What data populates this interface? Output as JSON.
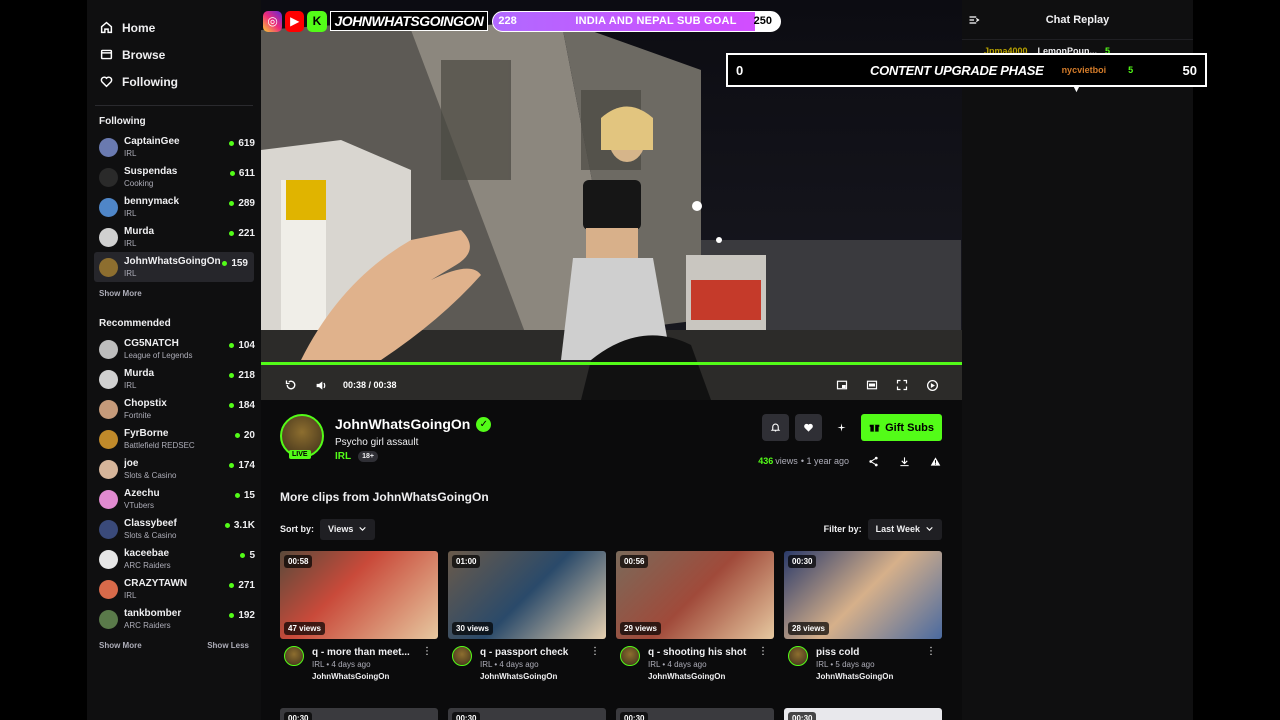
{
  "sidebar": {
    "nav": [
      {
        "label": "Home",
        "icon": "home-icon"
      },
      {
        "label": "Browse",
        "icon": "browse-icon"
      },
      {
        "label": "Following",
        "icon": "heart-icon"
      }
    ],
    "following_title": "Following",
    "following": [
      {
        "name": "CaptainGee",
        "category": "IRL",
        "viewers": "619",
        "color": "#6a7ab0"
      },
      {
        "name": "Suspendas",
        "category": "Cooking",
        "viewers": "611",
        "color": "#2a2a2a"
      },
      {
        "name": "bennymack",
        "category": "IRL",
        "viewers": "289",
        "color": "#4f86c8"
      },
      {
        "name": "Murda",
        "category": "IRL",
        "viewers": "221",
        "color": "#d0d0d0"
      },
      {
        "name": "JohnWhatsGoingOn",
        "category": "IRL",
        "viewers": "159",
        "color": "#8d6e2f",
        "active": true
      }
    ],
    "show_more": "Show More",
    "recommended_title": "Recommended",
    "recommended": [
      {
        "name": "CG5NATCH",
        "category": "League of Legends",
        "viewers": "104",
        "color": "#bdbdbd"
      },
      {
        "name": "Murda",
        "category": "IRL",
        "viewers": "218",
        "color": "#d0d0d0"
      },
      {
        "name": "Chopstix",
        "category": "Fortnite",
        "viewers": "184",
        "color": "#c59a7a"
      },
      {
        "name": "FyrBorne",
        "category": "Battlefield REDSEC",
        "viewers": "20",
        "color": "#c08a2a"
      },
      {
        "name": "joe",
        "category": "Slots & Casino",
        "viewers": "174",
        "color": "#d6b59a"
      },
      {
        "name": "Azechu",
        "category": "VTubers",
        "viewers": "15",
        "color": "#e08ad0"
      },
      {
        "name": "Classybeef",
        "category": "Slots & Casino",
        "viewers": "3.1K",
        "color": "#3a4a7a"
      },
      {
        "name": "kaceebae",
        "category": "ARC Raiders",
        "viewers": "5",
        "color": "#e6e6e6"
      },
      {
        "name": "CRAZYTAWN",
        "category": "IRL",
        "viewers": "271",
        "color": "#d86a4a"
      },
      {
        "name": "tankbomber",
        "category": "ARC Raiders",
        "viewers": "192",
        "color": "#5a7a4a"
      }
    ],
    "show_more_2": "Show More",
    "show_less": "Show Less"
  },
  "video": {
    "overlay": {
      "brand": "JOHNWHATSGOINGON",
      "goal_current": "228",
      "goal_label": "INDIA AND NEPAL SUB GOAL",
      "goal_target": "250",
      "goal_progress": 0.912
    },
    "time": "00:38 / 00:38",
    "progress": 1.0
  },
  "banner": {
    "left_num": "0",
    "title": "CONTENT UPGRADE PHASE",
    "right_num": "50",
    "chat_user": "nycvietboi",
    "chat_count": "5"
  },
  "clip": {
    "channel": "JohnWhatsGoingOn",
    "title": "Psycho girl assault",
    "live_badge": "LIVE",
    "category": "IRL",
    "age_badge": "18+",
    "views": "436",
    "views_word": "views",
    "age": "• 1 year ago",
    "gift_label": "Gift Subs"
  },
  "more": {
    "title": "More clips from JohnWhatsGoingOn",
    "sort_label": "Sort by:",
    "sort_value": "Views",
    "filter_label": "Filter by:",
    "filter_value": "Last Week",
    "clips": [
      {
        "duration": "00:58",
        "views": "47 views",
        "title": "q - more than meet...",
        "meta": "IRL • 4 days ago",
        "channel": "JohnWhatsGoingOn"
      },
      {
        "duration": "01:00",
        "views": "30 views",
        "title": "q - passport check",
        "meta": "IRL • 4 days ago",
        "channel": "JohnWhatsGoingOn"
      },
      {
        "duration": "00:56",
        "views": "29 views",
        "title": "q - shooting his shot",
        "meta": "IRL • 4 days ago",
        "channel": "JohnWhatsGoingOn"
      },
      {
        "duration": "00:30",
        "views": "28 views",
        "title": "piss cold",
        "meta": "IRL • 5 days ago",
        "channel": "JohnWhatsGoingOn"
      }
    ],
    "row2_durations": [
      "00:30",
      "00:30",
      "00:30",
      "00:30"
    ]
  },
  "chat": {
    "title": "Chat Replay",
    "pinned": [
      "Jpma4000",
      "LemonPoun...",
      "5"
    ]
  },
  "colors": {
    "accent": "#53fc18",
    "goal_fill": "#c05cff"
  }
}
